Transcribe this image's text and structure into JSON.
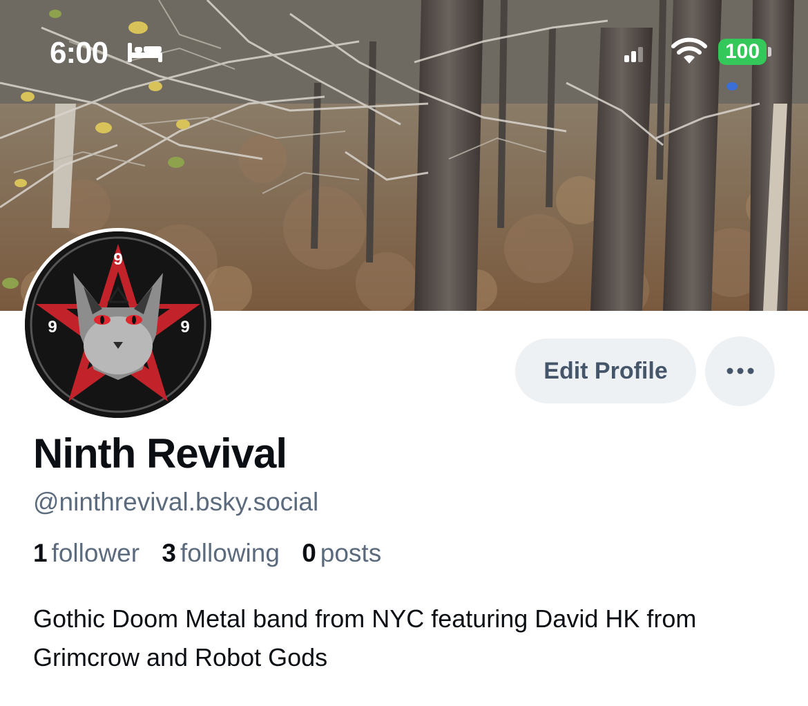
{
  "status_bar": {
    "time": "6:00",
    "battery": "100",
    "icons": [
      "bed-icon",
      "cellular-signal-icon",
      "wifi-icon",
      "battery-icon"
    ]
  },
  "avatar": {
    "label": "Ninth Revival",
    "badge_digit": "9"
  },
  "actions": {
    "edit_profile": "Edit Profile",
    "more": "more-options-icon"
  },
  "profile": {
    "display_name": "Ninth Revival",
    "handle": "@ninthrevival.bsky.social",
    "stats": [
      {
        "count": "1",
        "label": "follower"
      },
      {
        "count": "3",
        "label": "following"
      },
      {
        "count": "0",
        "label": "posts"
      }
    ],
    "bio": "Gothic Doom Metal band from NYC featuring David HK from Grimcrow and Robot Gods"
  },
  "colors": {
    "button_bg": "#eef1f4",
    "button_text": "#45566a",
    "secondary_text": "#5b6b7d",
    "primary_text": "#0b0f14",
    "battery": "#34c759",
    "avatar_red": "#c2232b"
  }
}
